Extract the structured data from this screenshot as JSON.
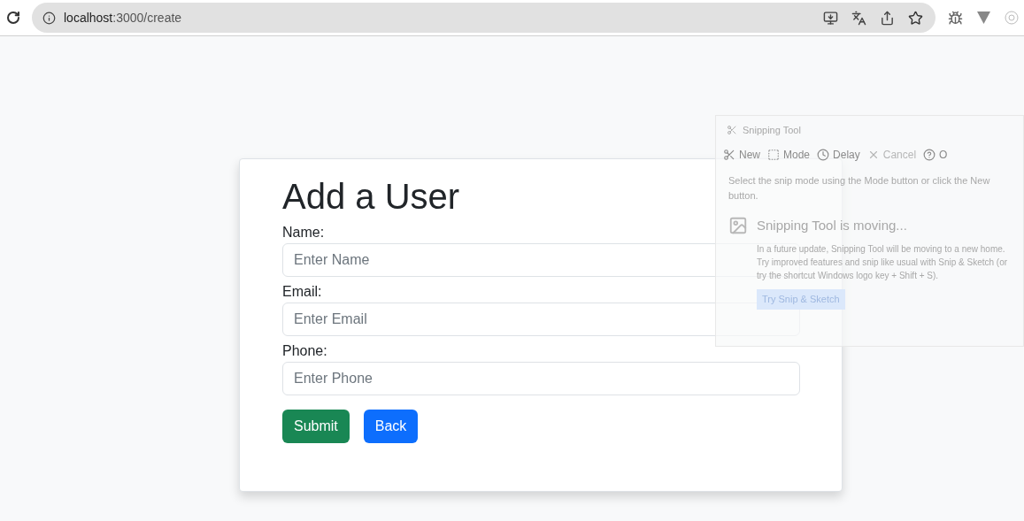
{
  "browser": {
    "url_host": "localhost",
    "url_path": ":3000/create"
  },
  "form": {
    "title": "Add a User",
    "fields": [
      {
        "label": "Name:",
        "placeholder": "Enter Name"
      },
      {
        "label": "Email:",
        "placeholder": "Enter Email"
      },
      {
        "label": "Phone:",
        "placeholder": "Enter Phone"
      }
    ],
    "buttons": [
      {
        "label": "Submit",
        "kind": "success"
      },
      {
        "label": "Back",
        "kind": "primary"
      }
    ]
  },
  "ghost_window": {
    "title": "Snipping Tool",
    "toolbar": [
      {
        "label": "New",
        "kind": "new",
        "disabled": false
      },
      {
        "label": "Mode",
        "kind": "mode",
        "disabled": false
      },
      {
        "label": "Delay",
        "kind": "delay",
        "disabled": false
      },
      {
        "label": "Cancel",
        "kind": "cancel",
        "disabled": true
      },
      {
        "label": "O",
        "kind": "options",
        "disabled": false
      }
    ],
    "hint": "Select the snip mode using the Mode button or click the New button.",
    "notice_title": "Snipping Tool is moving...",
    "notice_body": "In a future update, Snipping Tool will be moving to a new home. Try improved features and snip like usual with Snip & Sketch (or try the shortcut Windows logo key + Shift + S).",
    "notice_button": "Try Snip & Sketch"
  }
}
